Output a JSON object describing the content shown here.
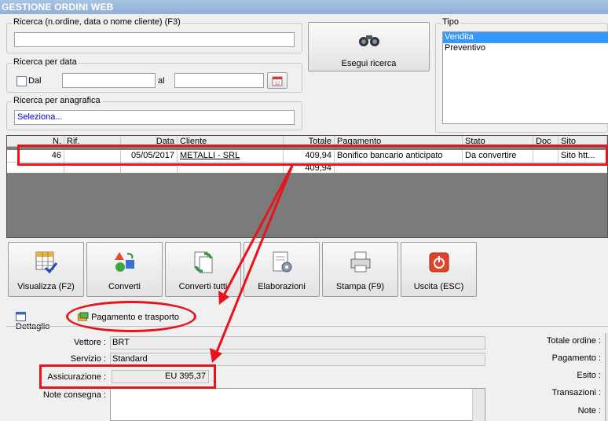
{
  "window": {
    "title": "GESTIONE ORDINI WEB"
  },
  "search": {
    "label": "Ricerca (n.ordine, data o nome cliente) (F3)",
    "value": ""
  },
  "date_search": {
    "label": "Ricerca per data",
    "from_label": "Dal",
    "to_label": "al",
    "from_value": "",
    "to_value": "",
    "calendar_icon": "calendar-icon"
  },
  "registry_search": {
    "label": "Ricerca per anagrafica",
    "value": "Seleziona..."
  },
  "run_search": {
    "label": "Esegui ricerca",
    "icon": "binoculars-icon"
  },
  "type": {
    "label": "Tipo",
    "options": [
      "Vendita",
      "Preventivo"
    ],
    "selected": "Vendita"
  },
  "orders": {
    "headers": [
      "N.",
      "Rif.",
      "Data",
      "Cliente",
      "Totale",
      "Pagamento",
      "Stato",
      "Doc",
      "Sito"
    ],
    "rows": [
      {
        "n": "46",
        "rif": "",
        "data": "05/05/2017",
        "cliente": "METALLI - SRL",
        "totale": "409,94",
        "pagamento": "Bonifico bancario anticipato",
        "stato": "Da convertire",
        "doc": "",
        "sito": "Sito htt..."
      }
    ],
    "footer_total": "409,94"
  },
  "toolbar": [
    {
      "label": "Visualizza (F2)",
      "icon": "grid-check-icon"
    },
    {
      "label": "Converti",
      "icon": "convert-shapes-icon"
    },
    {
      "label": "Converti tutti",
      "icon": "convert-all-icon"
    },
    {
      "label": "Elaborazioni",
      "icon": "document-gear-icon"
    },
    {
      "label": "Stampa (F9)",
      "icon": "printer-icon"
    },
    {
      "label": "Uscita (ESC)",
      "icon": "power-exit-icon"
    }
  ],
  "tabs": [
    {
      "label": "Dettaglio",
      "icon": "table-icon"
    },
    {
      "label": "Pagamento e trasporto",
      "icon": "payment-icon"
    }
  ],
  "detail": {
    "vettore_label": "Vettore :",
    "vettore_value": "BRT",
    "servizio_label": "Servizio :",
    "servizio_value": "Standard",
    "assicurazione_label": "Assicurazione :",
    "assicurazione_value": "EU 395,37",
    "note_label": "Note consegna :",
    "note_value": ""
  },
  "summary": {
    "totale_label": "Totale ordine :",
    "pagamento_label": "Pagamento :",
    "esito_label": "Esito :",
    "transazioni_label": "Transazioni :",
    "note_label": "Note :"
  },
  "colors": {
    "annotation": "#e8131b",
    "title_bar": "#9ab8dd",
    "selection": "#3399ff"
  }
}
